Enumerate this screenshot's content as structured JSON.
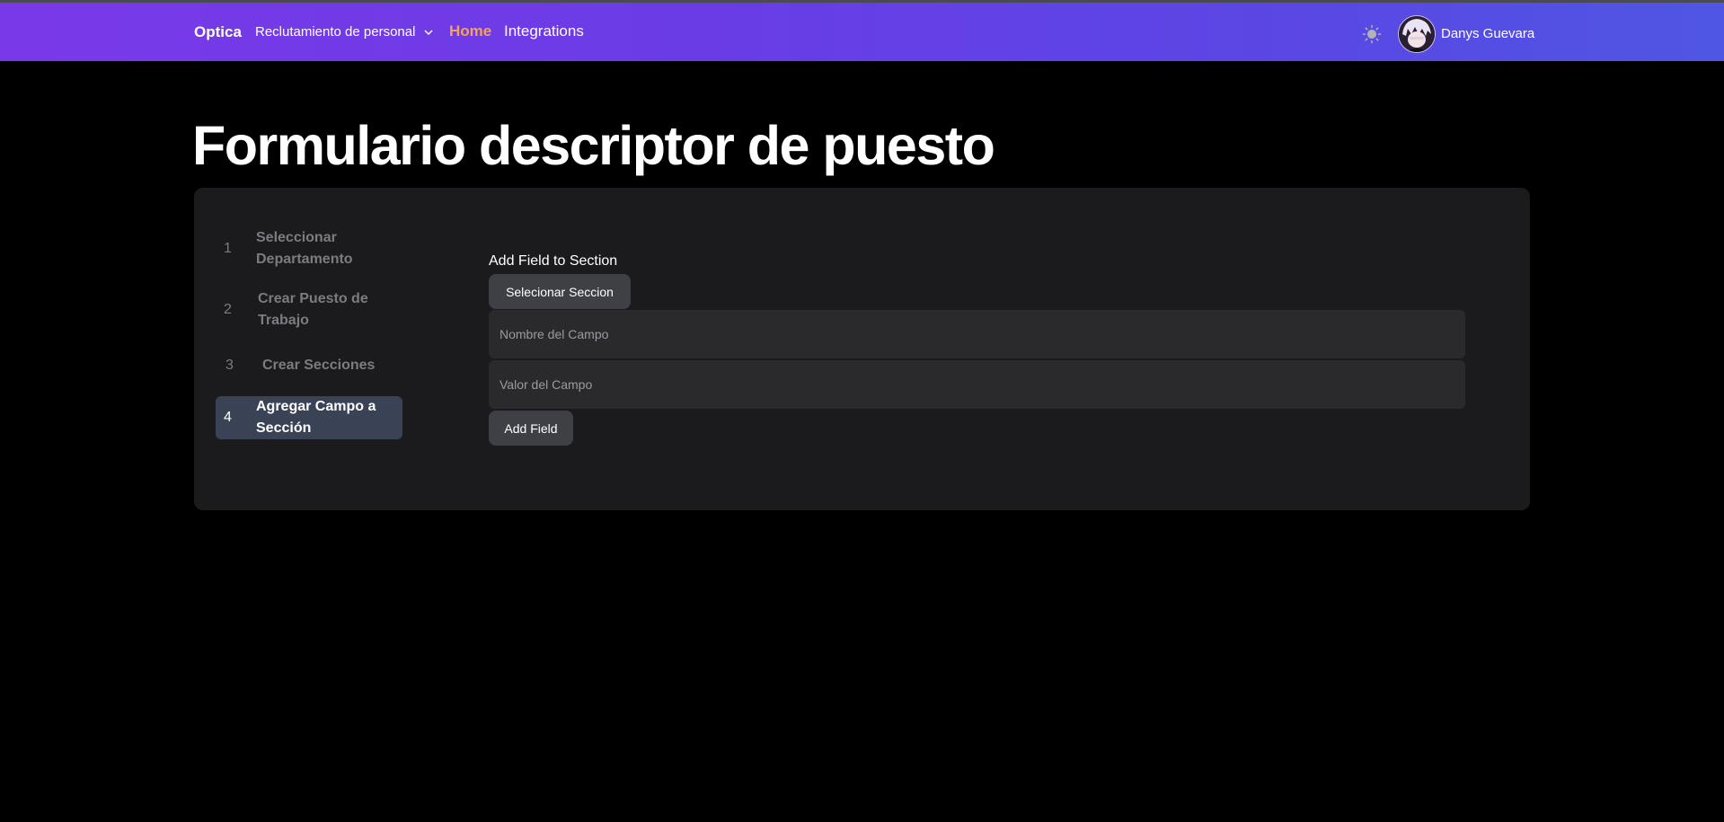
{
  "navbar": {
    "brand": "Optica",
    "dept_selector": "Reclutamiento de personal",
    "links": [
      "Home",
      "Integrations"
    ],
    "active_link_color": "#f4a257",
    "theme_icon": "sun-icon",
    "user_name": "Danys Guevara"
  },
  "page": {
    "title": "Formulario descriptor de puesto"
  },
  "steps": [
    {
      "number": "1",
      "label": "Seleccionar Departamento",
      "active": false
    },
    {
      "number": "2",
      "label": "Crear Puesto de Trabajo",
      "active": false
    },
    {
      "number": "3",
      "label": "Crear Secciones",
      "active": false
    },
    {
      "number": "4",
      "label": "Agregar Campo a Sección",
      "active": true
    }
  ],
  "form": {
    "heading": "Add Field to Section",
    "select_section_label": "Selecionar Seccion",
    "field_name_placeholder": "Nombre del Campo",
    "field_value_placeholder": "Valor del Campo",
    "submit_label": "Add Field"
  },
  "colors": {
    "nav_gradient_start": "#7a39e8",
    "nav_gradient_end": "#4f56e3",
    "card_bg": "#1b1b1d",
    "active_step_bg": "#3a4355"
  }
}
